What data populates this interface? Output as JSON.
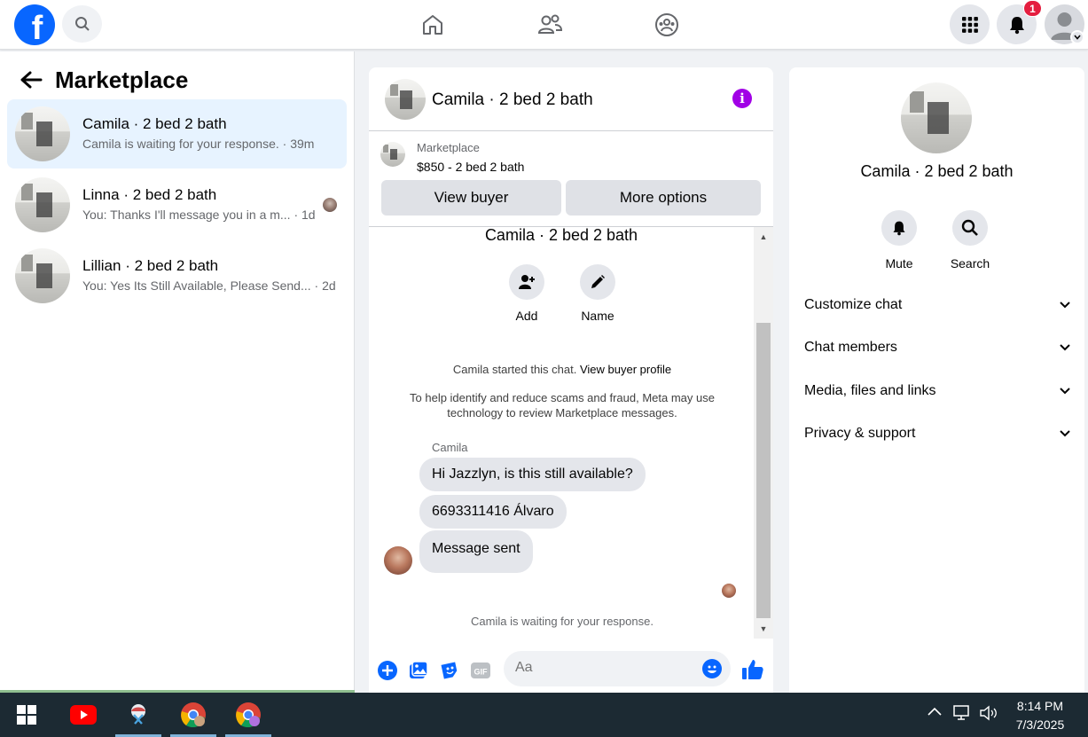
{
  "topbar": {
    "logo": "f",
    "notif_count": "1",
    "icons": [
      "facebook-logo-icon",
      "search-icon",
      "home-icon",
      "friends-icon",
      "groups-icon",
      "menu-grid-icon",
      "bell-icon",
      "profile-icon"
    ]
  },
  "sidebar": {
    "title": "Marketplace",
    "conversations": [
      {
        "title": "Camila · 2 bed 2 bath",
        "sub": "Camila is waiting for your response. · 39m"
      },
      {
        "title": "Linna · 2 bed 2 bath",
        "sub": "You: Thanks I'll message you in a m... · 1d"
      },
      {
        "title": "Lillian · 2 bed 2 bath",
        "sub": "You: Yes Its Still Available, Please Send... · 2d"
      }
    ]
  },
  "chat": {
    "title": "Camila · 2 bed 2 bath",
    "listing_label": "Marketplace",
    "listing_price": "$850 - 2 bed 2 bath",
    "view_buyer": "View buyer",
    "more_options": "More options",
    "mid_title": "Camila · 2 bed 2 bath",
    "add_label": "Add",
    "name_label": "Name",
    "started_text": "Camila started this chat.",
    "view_profile": "View buyer profile",
    "scam_notice": "To help identify and reduce scams and fraud, Meta may use technology to review Marketplace messages.",
    "sender": "Camila",
    "messages": [
      "Hi Jazzlyn, is this still available?",
      "6693311416 Álvaro",
      "Message sent"
    ],
    "waiting": "Camila is waiting for your response.",
    "composer_placeholder": "Aa"
  },
  "right_panel": {
    "title": "Camila · 2 bed 2 bath",
    "mute": "Mute",
    "search": "Search",
    "sections": [
      "Customize chat",
      "Chat members",
      "Media, files and links",
      "Privacy & support"
    ]
  },
  "taskbar": {
    "time": "8:14 PM",
    "date": "7/3/2025"
  },
  "colors": {
    "brand": "#0866ff",
    "info": "#a100e6",
    "badge": "#e41e3f",
    "active_conv": "#e7f3ff"
  }
}
